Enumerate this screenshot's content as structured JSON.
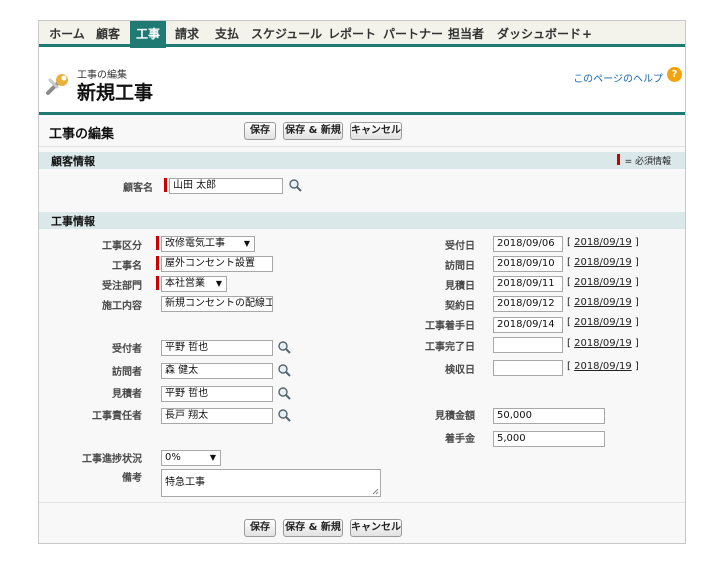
{
  "nav": {
    "tabs": [
      {
        "label": "ホーム",
        "active": false
      },
      {
        "label": "顧客",
        "active": false
      },
      {
        "label": "工事",
        "active": true
      },
      {
        "label": "請求",
        "active": false
      },
      {
        "label": "支払",
        "active": false
      },
      {
        "label": "スケジュール",
        "active": false
      },
      {
        "label": "レポート",
        "active": false
      },
      {
        "label": "パートナー",
        "active": false
      },
      {
        "label": "担当者",
        "active": false
      },
      {
        "label": "ダッシュボード",
        "active": false
      },
      {
        "label": "+",
        "active": false
      }
    ]
  },
  "header": {
    "kicker": "工事の編集",
    "title": "新規工事",
    "help_link": "このページのヘルプ",
    "help_icon": "?"
  },
  "block": {
    "title": "工事の編集",
    "buttons": {
      "save": "保存",
      "save_new": "保存 & 新規",
      "cancel": "キャンセル"
    },
    "required_legend": "= 必須情報"
  },
  "customer_section": {
    "title": "顧客情報",
    "customer_label": "顧客名",
    "customer_value": "山田 太郎"
  },
  "work_section": {
    "title": "工事情報",
    "left": {
      "type_label": "工事区分",
      "type_value": "改修電気工事",
      "name_label": "工事名",
      "name_value": "屋外コンセント設置",
      "dept_label": "受注部門",
      "dept_value": "本社営業",
      "content_label": "施工内容",
      "content_value": "新規コンセントの配線工事",
      "receiver_label": "受付者",
      "receiver_value": "平野 哲也",
      "visitor_label": "訪問者",
      "visitor_value": "森 健太",
      "estimator_label": "見積者",
      "estimator_value": "平野 哲也",
      "manager_label": "工事責任者",
      "manager_value": "長戸 翔太",
      "progress_label": "工事進捗状況",
      "progress_value": "0%",
      "note_label": "備考",
      "note_value": "特急工事"
    },
    "right": {
      "received_label": "受付日",
      "received_value": "2018/09/06",
      "visit_label": "訪問日",
      "visit_value": "2018/09/10",
      "estimate_label": "見積日",
      "estimate_value": "2018/09/11",
      "contract_label": "契約日",
      "contract_value": "2018/09/12",
      "start_label": "工事着手日",
      "start_value": "2018/09/14",
      "complete_label": "工事完了日",
      "complete_value": "",
      "inspect_label": "検収日",
      "inspect_value": "",
      "today_link": "2018/09/19",
      "est_amount_label": "見積金額",
      "est_amount_value": "50,000",
      "deposit_label": "着手金",
      "deposit_value": "5,000"
    }
  },
  "colors": {
    "accent": "#1f7a74",
    "section_bg": "#dbe8ea",
    "required": "#cc0000",
    "link": "#1566b3",
    "help_icon": "#f6a20a"
  },
  "icons": [
    "wrench-icon",
    "help-icon",
    "lookup-icon",
    "dropdown-arrow-icon",
    "resize-grip-icon"
  ]
}
